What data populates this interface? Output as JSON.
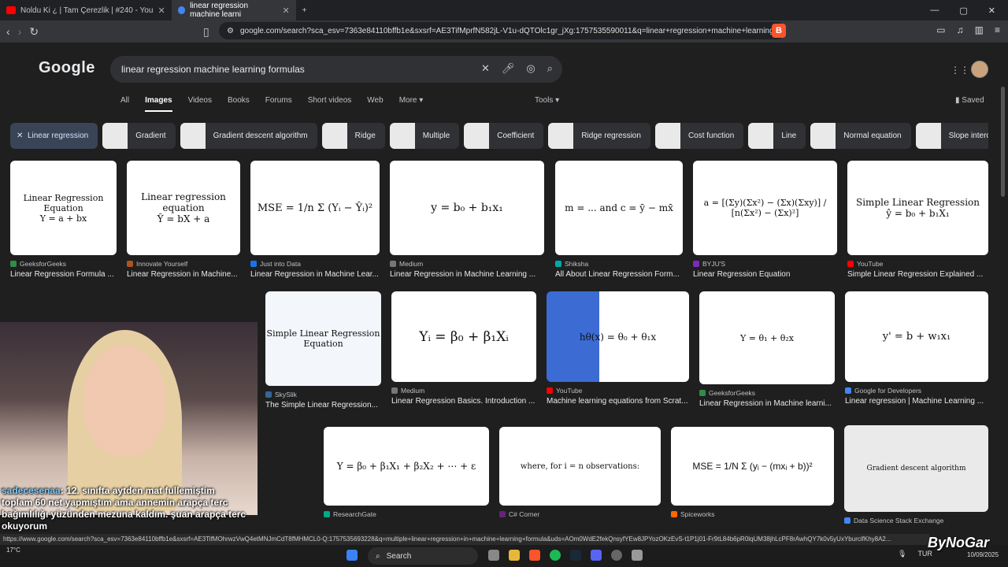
{
  "tabs": [
    {
      "label": "Noldu Ki ¿ | Tam Çerezlik | #240 - You"
    },
    {
      "label": "linear regression machine learni"
    }
  ],
  "url": "google.com/search?sca_esv=7363e84110bffb1e&sxsrf=AE3TifMprfN582jL-V1u-dQTOlc1gr_jXg:1757535590011&q=linear+regression+machine+learning+...",
  "search_query": "linear regression machine learning formulas",
  "logo": "Google",
  "nav": [
    "All",
    "Images",
    "Videos",
    "Books",
    "Forums",
    "Short videos",
    "Web",
    "More"
  ],
  "tools_label": "Tools",
  "saved_label": "Saved",
  "chips": [
    "Linear regression",
    "Gradient",
    "Gradient descent algorithm",
    "Ridge",
    "Multiple",
    "Coefficient",
    "Ridge regression",
    "Cost function",
    "Line",
    "Normal equation",
    "Slope intercept"
  ],
  "results": [
    {
      "img": "Linear Regression Equation\nY = a + bx",
      "source": "GeeksforGeeks",
      "title": "Linear Regression Formula ..."
    },
    {
      "img": "Linear regression equation\nŶ = bX + a",
      "source": "Innovate Yourself",
      "title": "Linear Regression in Machine..."
    },
    {
      "img": "MSE = 1/n Σ (Yᵢ − Ŷᵢ)²",
      "source": "Just into Data",
      "title": "Linear Regression in Machine Lear..."
    },
    {
      "img": "y = b₀ + b₁x₁",
      "source": "Medium",
      "title": "Linear Regression in Machine Learning ..."
    },
    {
      "img": "m = ... and c = ȳ − mx̄",
      "source": "Shiksha",
      "title": "All About Linear Regression Form..."
    },
    {
      "img": "a = [(Σy)(Σx²) − (Σx)(Σxy)] / [n(Σx²) − (Σx)²]",
      "source": "BYJU'S",
      "title": "Linear Regression Equation"
    },
    {
      "img": "Simple Linear Regression\nŷ = b₀ + b₁X₁",
      "source": "YouTube",
      "title": "Simple Linear Regression Explained ..."
    },
    {
      "img": "Simple Linear Regression Equation",
      "source": "SkySlik",
      "title": "The Simple Linear Regression..."
    },
    {
      "img": "Yᵢ = β₀ + β₁Xᵢ",
      "source": "Medium",
      "title": "Linear Regression Basics. Introduction ..."
    },
    {
      "img": "hθ(x) = θ₀ + θ₁x",
      "source": "YouTube",
      "title": "Machine learning equations from Scrat..."
    },
    {
      "img": "Y = θ₁ + θ₂x",
      "source": "GeeksforGeeks",
      "title": "Linear Regression in Machine learni..."
    },
    {
      "img": "y' = b + w₁x₁",
      "source": "Google for Developers",
      "title": "Linear regression | Machine Learning ..."
    },
    {
      "img": "Y = β₀ + β₁X₁ + β₂X₂ + ⋯ + ε",
      "source": "ResearchGate",
      "title": ""
    },
    {
      "img": "where, for i = n observations:",
      "source": "C# Corner",
      "title": ""
    },
    {
      "img": "MSE = 1/N Σ (yᵢ − (mxᵢ + b))²",
      "source": "Spiceworks",
      "title": ""
    },
    {
      "img": "Gradient descent algorithm",
      "source": "Data Science Stack Exchange",
      "title": ""
    }
  ],
  "chat": {
    "user": "sadecesenaa",
    "msg1": ": 12. sınıfta aytden mat fullemiştim",
    "msg2": "toplam 60 net yapmıştım ama annemin arapça terc",
    "msg3": "bağımlılığı yüzünden mezuna kaldım. şuan arapça terc",
    "msg4": "okuyorum"
  },
  "status_url": "https://www.google.com/search?sca_esv=7363e84110bffb1e&sxsrf=AE3TifMOhrwzVwQ4etMNJmCdT8fMHMCL0-Q:1757535693228&q=multiple+linear+regression+in+machine+learning+formula&uds=AOm0WdE2fekQnsyfYEw8JPYozOKzEvS-t1P1j01-Fr9tL84b6pR0lqUM38jhLcPF8rAwhQY7k0v5yUxYburcifKhy8A2...",
  "taskbar": {
    "search": "Search",
    "lang": "TUR",
    "time": "10/09/2025",
    "weather": "17°C"
  },
  "watermark": "ByNoGar"
}
